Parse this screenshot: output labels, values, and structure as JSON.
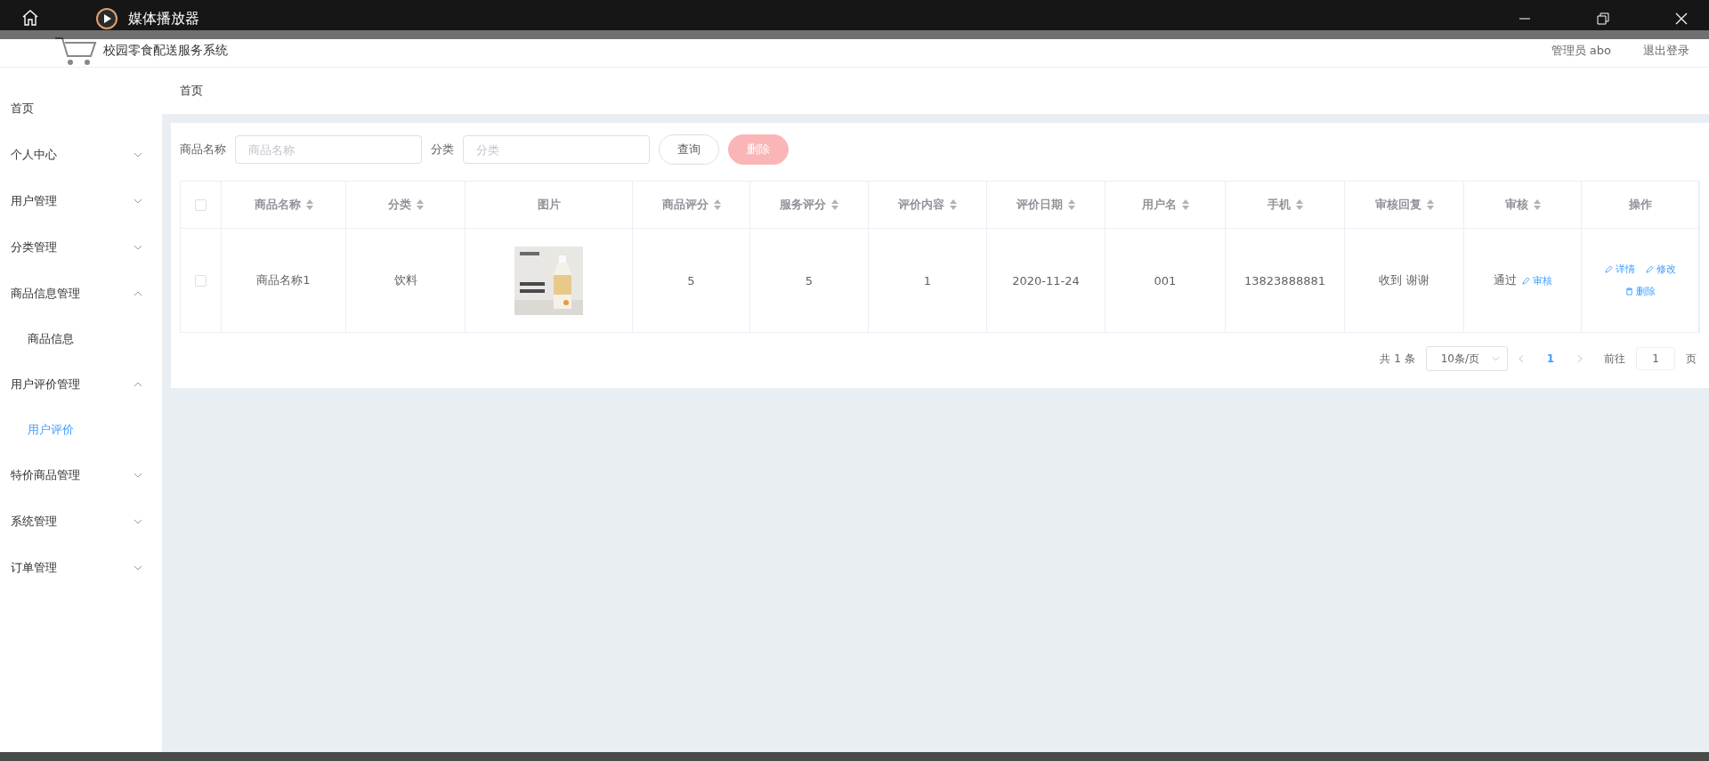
{
  "player": {
    "title": "媒体播放器"
  },
  "header": {
    "system_title": "校园零食配送服务系统",
    "user": "管理员 abo",
    "logout": "退出登录"
  },
  "sidebar": {
    "items": [
      {
        "label": "首页",
        "kind": "link",
        "selected": false
      },
      {
        "label": "个人中心",
        "kind": "menu",
        "expanded": false
      },
      {
        "label": "用户管理",
        "kind": "menu",
        "expanded": false
      },
      {
        "label": "分类管理",
        "kind": "menu",
        "expanded": false
      },
      {
        "label": "商品信息管理",
        "kind": "menu",
        "expanded": true,
        "children": [
          {
            "label": "商品信息",
            "selected": false
          }
        ]
      },
      {
        "label": "用户评价管理",
        "kind": "menu",
        "expanded": true,
        "children": [
          {
            "label": "用户评价",
            "selected": true
          }
        ]
      },
      {
        "label": "特价商品管理",
        "kind": "menu",
        "expanded": false
      },
      {
        "label": "系统管理",
        "kind": "menu",
        "expanded": false
      },
      {
        "label": "订单管理",
        "kind": "menu",
        "expanded": false
      }
    ]
  },
  "breadcrumb": [
    "首页"
  ],
  "search": {
    "fields": [
      {
        "label": "商品名称",
        "placeholder": "商品名称"
      },
      {
        "label": "分类",
        "placeholder": "分类"
      }
    ],
    "buttons": [
      {
        "label": "查询",
        "kind": "default",
        "disabled": false
      },
      {
        "label": "删除",
        "kind": "danger",
        "disabled": true
      }
    ]
  },
  "table": {
    "columns": [
      {
        "label": "商品名称",
        "sortable": true
      },
      {
        "label": "分类",
        "sortable": true
      },
      {
        "label": "图片",
        "sortable": false
      },
      {
        "label": "商品评分",
        "sortable": true
      },
      {
        "label": "服务评分",
        "sortable": true
      },
      {
        "label": "评价内容",
        "sortable": true
      },
      {
        "label": "评价日期",
        "sortable": true
      },
      {
        "label": "用户名",
        "sortable": true
      },
      {
        "label": "手机",
        "sortable": true
      },
      {
        "label": "审核回复",
        "sortable": true
      },
      {
        "label": "审核",
        "sortable": true
      },
      {
        "label": "操作",
        "sortable": false
      }
    ],
    "header_checked": false,
    "rows": [
      {
        "checked": false,
        "cells": [
          {
            "kind": "text",
            "text": "商品名称1"
          },
          {
            "kind": "text",
            "text": "饮料"
          },
          {
            "kind": "picture"
          },
          {
            "kind": "text",
            "text": "5"
          },
          {
            "kind": "text",
            "text": "5"
          },
          {
            "kind": "text",
            "text": "1"
          },
          {
            "kind": "text",
            "text": "2020-11-24"
          },
          {
            "kind": "text",
            "text": "001"
          },
          {
            "kind": "text",
            "text": "13823888881"
          },
          {
            "kind": "text",
            "text": "收到 谢谢"
          },
          {
            "kind": "status",
            "text": "通过",
            "action": "审核"
          },
          {
            "kind": "actions",
            "actions": [
              {
                "label": "详情"
              },
              {
                "label": "修改"
              },
              {
                "label": "删除"
              }
            ]
          }
        ]
      }
    ]
  },
  "pagination": {
    "total": "共 1 条",
    "page_size": "10条/页",
    "pages": [
      {
        "label": "1",
        "selected": true
      }
    ],
    "goto_label": "前往",
    "goto_value": "1",
    "goto_suffix": "页"
  }
}
